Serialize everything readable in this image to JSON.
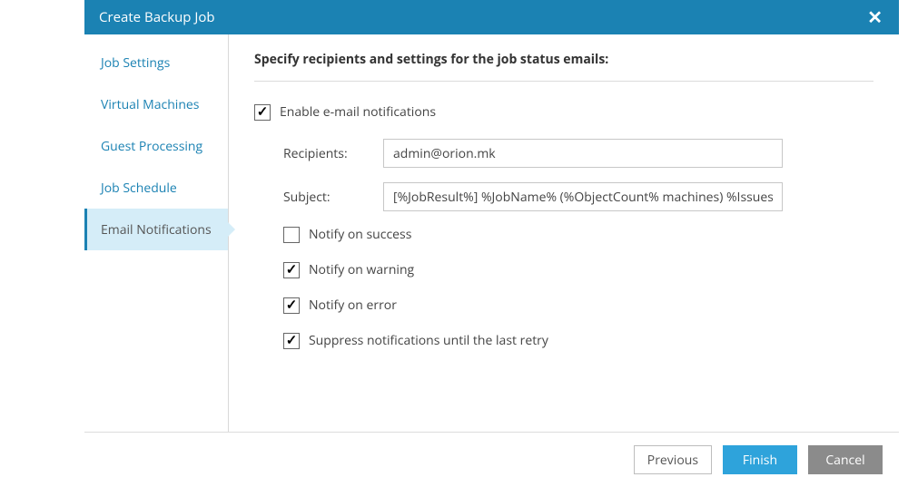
{
  "dialog": {
    "title": "Create Backup Job"
  },
  "sidebar": {
    "items": [
      {
        "label": "Job Settings"
      },
      {
        "label": "Virtual Machines"
      },
      {
        "label": "Guest Processing"
      },
      {
        "label": "Job Schedule"
      },
      {
        "label": "Email Notifications"
      }
    ],
    "activeIndex": 4
  },
  "main": {
    "heading": "Specify recipients and settings for the job status emails:",
    "enable_label": "Enable e-mail notifications",
    "enable_checked": true,
    "recipients_label": "Recipients:",
    "recipients_value": "admin@orion.mk",
    "subject_label": "Subject:",
    "subject_value": "[%JobResult%] %JobName% (%ObjectCount% machines) %Issues%",
    "notify_success": {
      "label": "Notify on success",
      "checked": false
    },
    "notify_warning": {
      "label": "Notify on warning",
      "checked": true
    },
    "notify_error": {
      "label": "Notify on error",
      "checked": true
    },
    "suppress": {
      "label": "Suppress notifications until the last retry",
      "checked": true
    }
  },
  "footer": {
    "previous": "Previous",
    "finish": "Finish",
    "cancel": "Cancel"
  }
}
